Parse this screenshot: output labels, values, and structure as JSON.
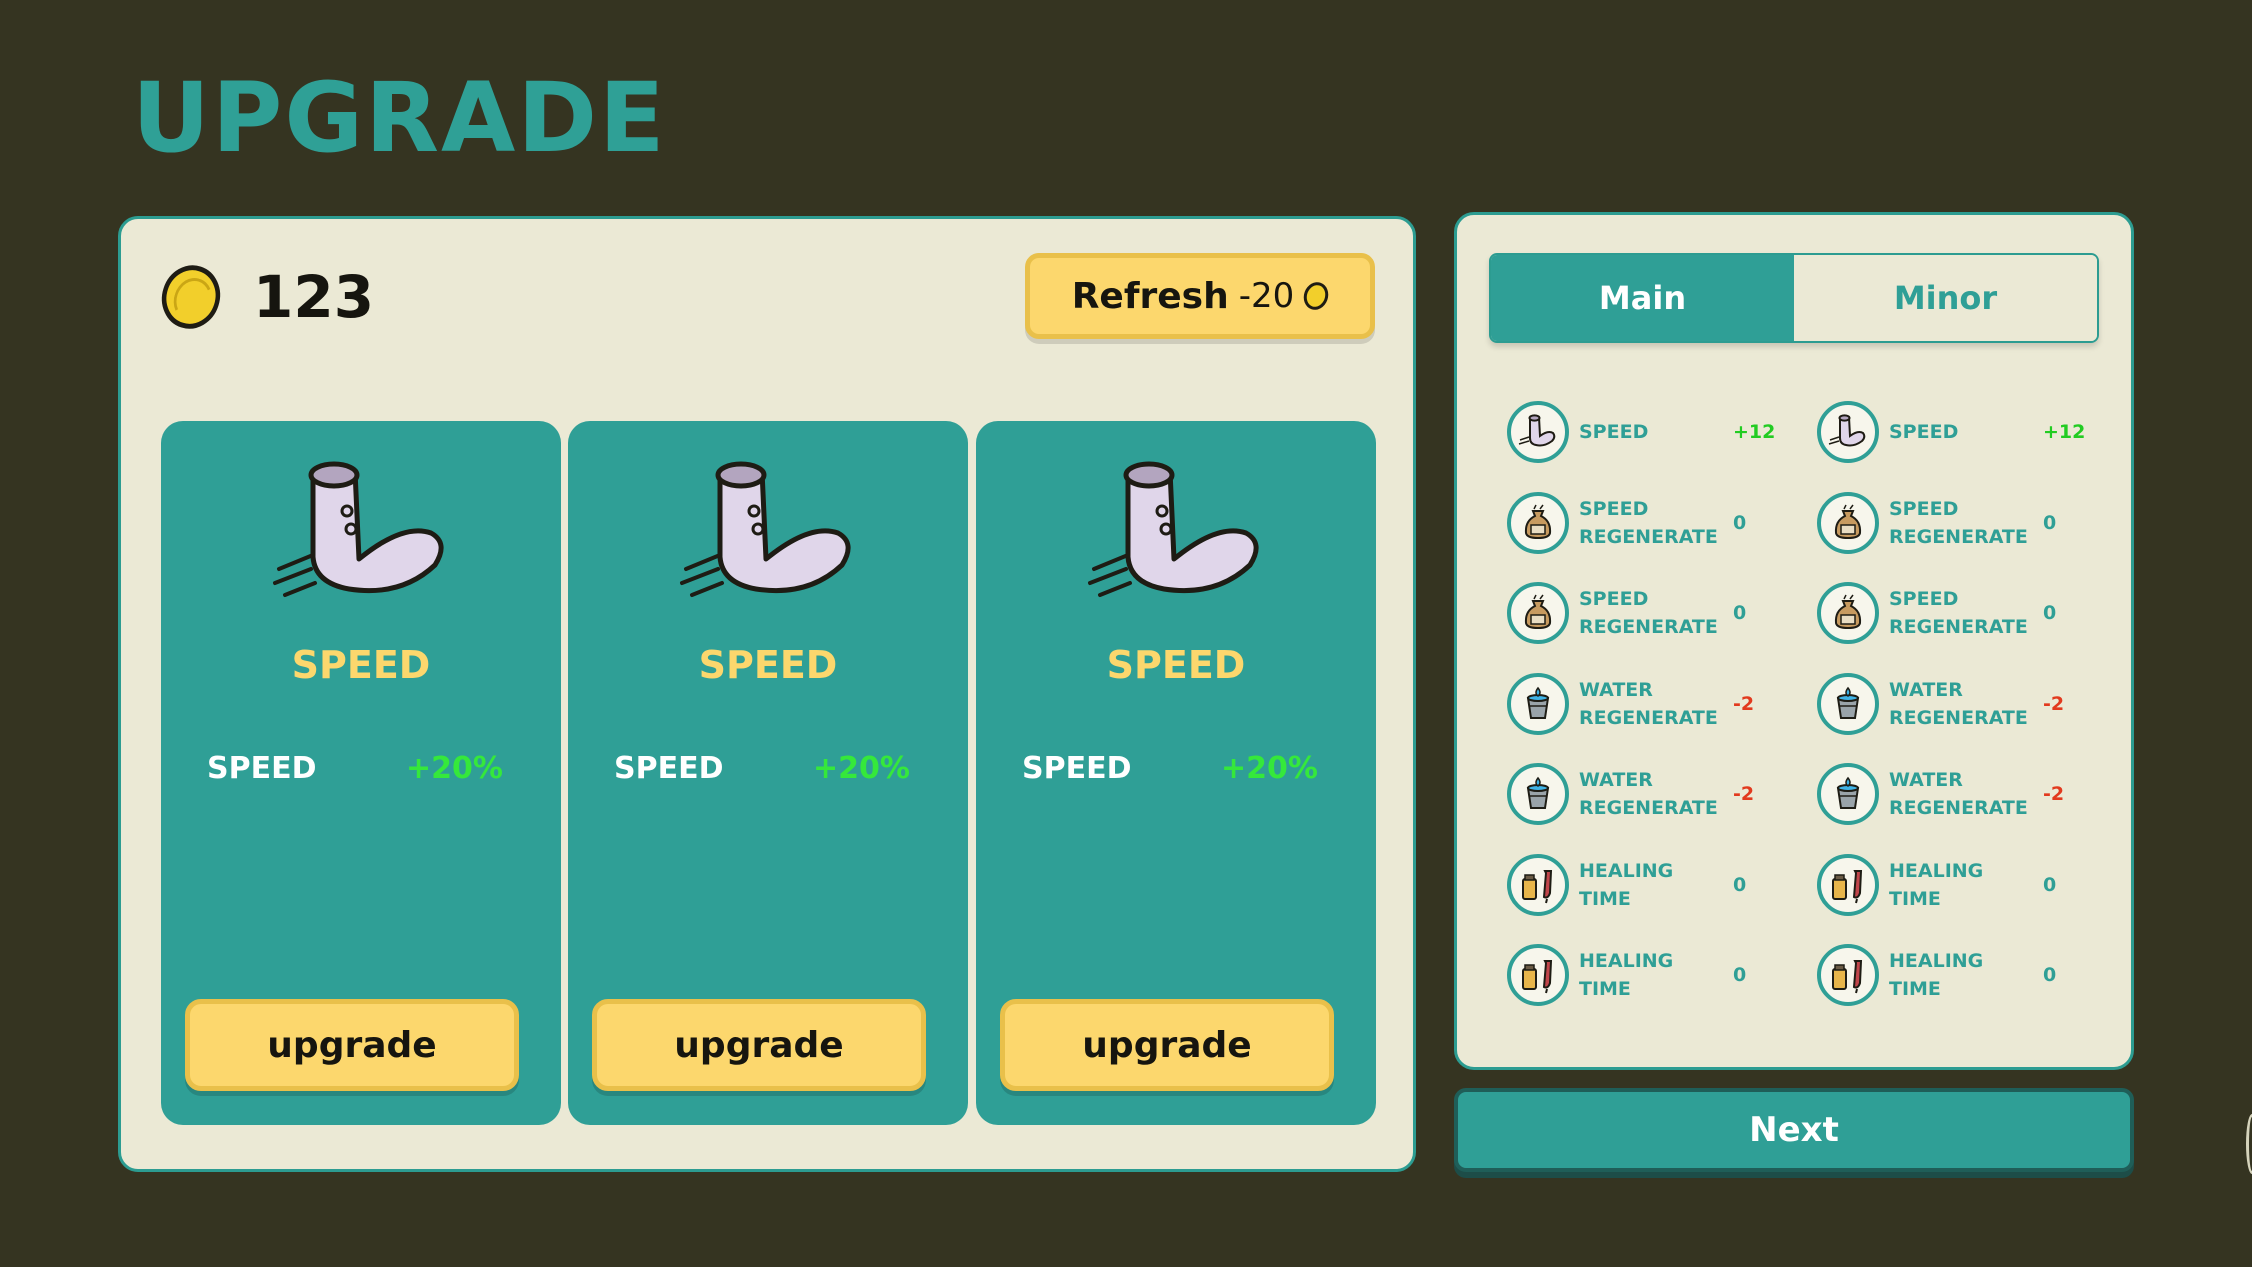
{
  "title": "UPGRADE",
  "coins": "123",
  "refresh": {
    "label": "Refresh",
    "cost": "-20"
  },
  "cards": [
    {
      "name": "SPEED",
      "stat_label": "SPEED",
      "stat_value": "+20%",
      "button": "upgrade",
      "icon": "sock-icon"
    },
    {
      "name": "SPEED",
      "stat_label": "SPEED",
      "stat_value": "+20%",
      "button": "upgrade",
      "icon": "sock-icon"
    },
    {
      "name": "SPEED",
      "stat_label": "SPEED",
      "stat_value": "+20%",
      "button": "upgrade",
      "icon": "sock-icon"
    }
  ],
  "tabs": [
    {
      "label": "Main",
      "active": true
    },
    {
      "label": "Minor",
      "active": false
    }
  ],
  "stats": [
    {
      "name": "SPEED",
      "value": "+12",
      "icon": "sock-icon",
      "tone": "pos"
    },
    {
      "name": "SPEED",
      "value": "+12",
      "icon": "sock-icon",
      "tone": "pos"
    },
    {
      "name": "SPEED\nREGENERATE",
      "value": "0",
      "icon": "food-bag-icon",
      "tone": "zero"
    },
    {
      "name": "SPEED\nREGENERATE",
      "value": "0",
      "icon": "food-bag-icon",
      "tone": "zero"
    },
    {
      "name": "SPEED\nREGENERATE",
      "value": "0",
      "icon": "food-bag-icon",
      "tone": "zero"
    },
    {
      "name": "SPEED\nREGENERATE",
      "value": "0",
      "icon": "food-bag-icon",
      "tone": "zero"
    },
    {
      "name": "WATER\nREGENERATE",
      "value": "-2",
      "icon": "water-bucket-icon",
      "tone": "neg"
    },
    {
      "name": "WATER\nREGENERATE",
      "value": "-2",
      "icon": "water-bucket-icon",
      "tone": "neg"
    },
    {
      "name": "WATER\nREGENERATE",
      "value": "-2",
      "icon": "water-bucket-icon",
      "tone": "neg"
    },
    {
      "name": "WATER\nREGENERATE",
      "value": "-2",
      "icon": "water-bucket-icon",
      "tone": "neg"
    },
    {
      "name": "HEALING\nTIME",
      "value": "0",
      "icon": "medicine-icon",
      "tone": "zero"
    },
    {
      "name": "HEALING\nTIME",
      "value": "0",
      "icon": "medicine-icon",
      "tone": "zero"
    },
    {
      "name": "HEALING\nTIME",
      "value": "0",
      "icon": "medicine-icon",
      "tone": "zero"
    },
    {
      "name": "HEALING\nTIME",
      "value": "0",
      "icon": "medicine-icon",
      "tone": "zero"
    }
  ],
  "next_label": "Next",
  "colors": {
    "background": "#353421",
    "panel": "#ebe9d5",
    "teal": "#2f9f96",
    "yellow": "#fcd76d",
    "green": "#35e83b",
    "red": "#e23a1e"
  }
}
